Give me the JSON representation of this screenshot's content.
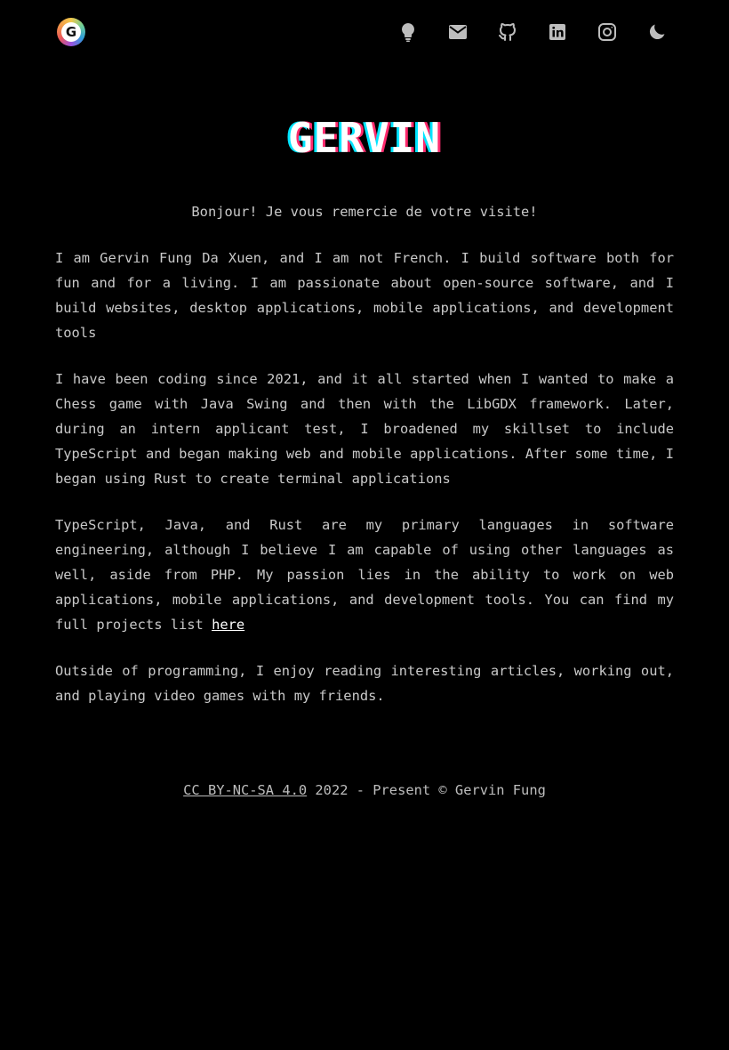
{
  "nav": {
    "logo_letter": "G",
    "icons": [
      {
        "name": "lightbulb-icon"
      },
      {
        "name": "mail-icon"
      },
      {
        "name": "github-icon"
      },
      {
        "name": "linkedin-icon"
      },
      {
        "name": "instagram-icon"
      },
      {
        "name": "moon-icon"
      }
    ],
    "icon_color": "#bdbdbd"
  },
  "header": {
    "title": "GERVIN"
  },
  "about": {
    "greeting": "Bonjour! Je vous remercie de votre visite!",
    "p1": "I am Gervin Fung Da Xuen, and I am not French. I build software both for fun and for a living. I am passionate about open-source software, and I build websites, desktop applications, mobile applications, and development tools",
    "p2": "I have been coding since 2021, and it all started when I wanted to make a Chess game with Java Swing and then with the LibGDX framework. Later, during an intern applicant test, I broadened my skillset to include TypeScript and began making web and mobile applications. After some time, I began using Rust to create terminal applications",
    "p3_text": "TypeScript, Java, and Rust are my primary languages in software engineering, although I believe I am capable of using other languages as well, aside from PHP. My passion lies in the ability to work on web applications, mobile applications, and development tools. You can find my full projects list ",
    "p3_link": "here",
    "p4": "Outside of programming, I enjoy reading interesting articles, working out, and playing video games with my friends."
  },
  "footer": {
    "license_link": "CC BY-NC-SA 4.0",
    "text": " 2022 - Present © Gervin Fung"
  },
  "colors": {
    "background": "#000000",
    "text": "#c9c9c9",
    "title_shadow_cyan": "#00e5ff",
    "title_shadow_pink": "#ff2a6d"
  }
}
